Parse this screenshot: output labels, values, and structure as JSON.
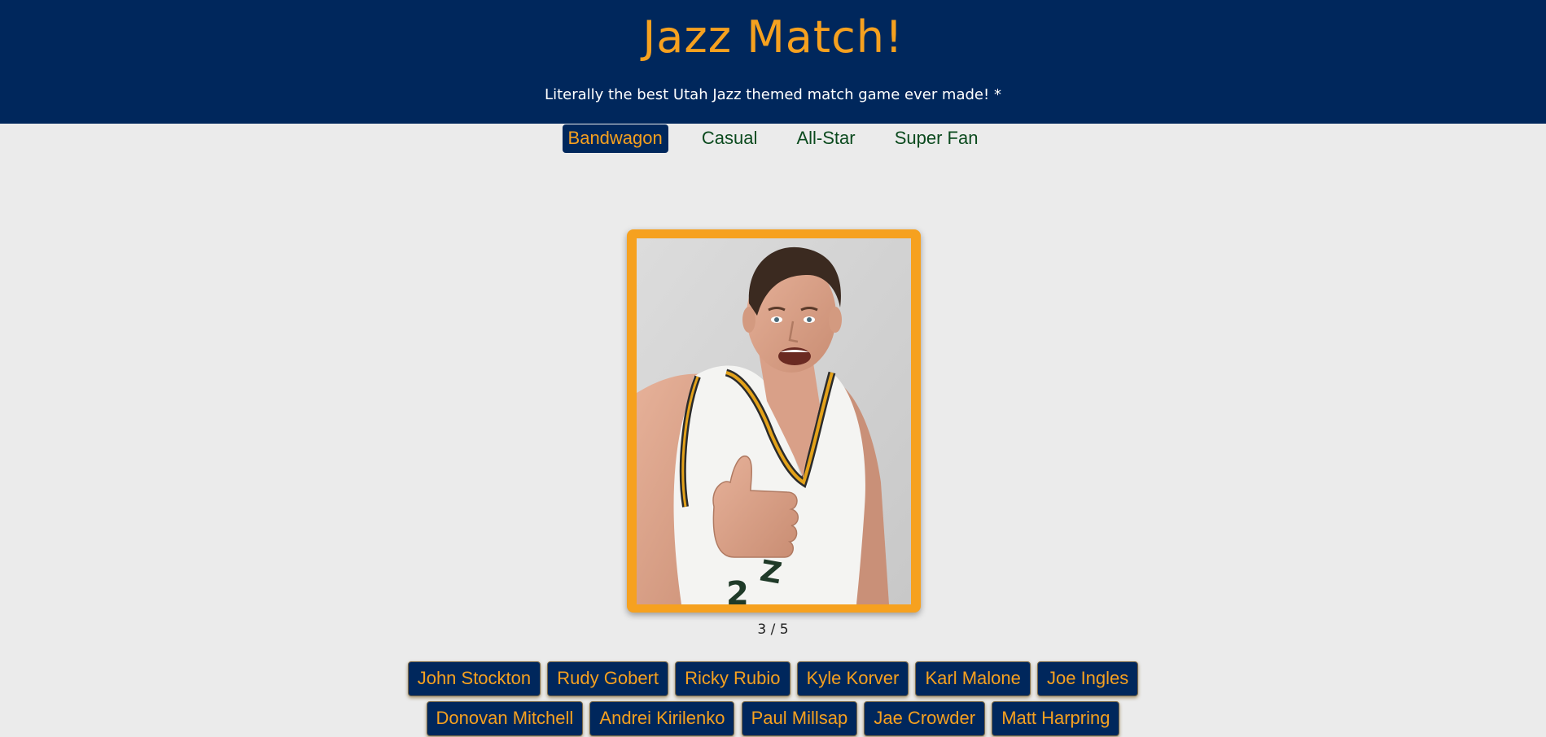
{
  "header": {
    "title": "Jazz Match!",
    "subtitle": "Literally the best Utah Jazz themed match game ever made! *"
  },
  "levels": [
    {
      "label": "Bandwagon",
      "active": true
    },
    {
      "label": "Casual",
      "active": false
    },
    {
      "label": "All-Star",
      "active": false
    },
    {
      "label": "Super Fan",
      "active": false
    }
  ],
  "card": {
    "image_alt": "Smiling player in white Jazz jersey giving a thumbs up"
  },
  "progress": {
    "text": "3 / 5",
    "current": 3,
    "total": 5
  },
  "answers": {
    "row1": [
      "John Stockton",
      "Rudy Gobert",
      "Ricky Rubio",
      "Kyle Korver",
      "Karl Malone",
      "Joe Ingles"
    ],
    "row2": [
      "Donovan Mitchell",
      "Andrei Kirilenko",
      "Paul Millsap",
      "Jae Crowder",
      "Matt Harpring"
    ]
  },
  "colors": {
    "navy": "#00275c",
    "gold": "#f6a11f",
    "background": "#ebebeb",
    "nav_text": "#0b4a1e"
  }
}
